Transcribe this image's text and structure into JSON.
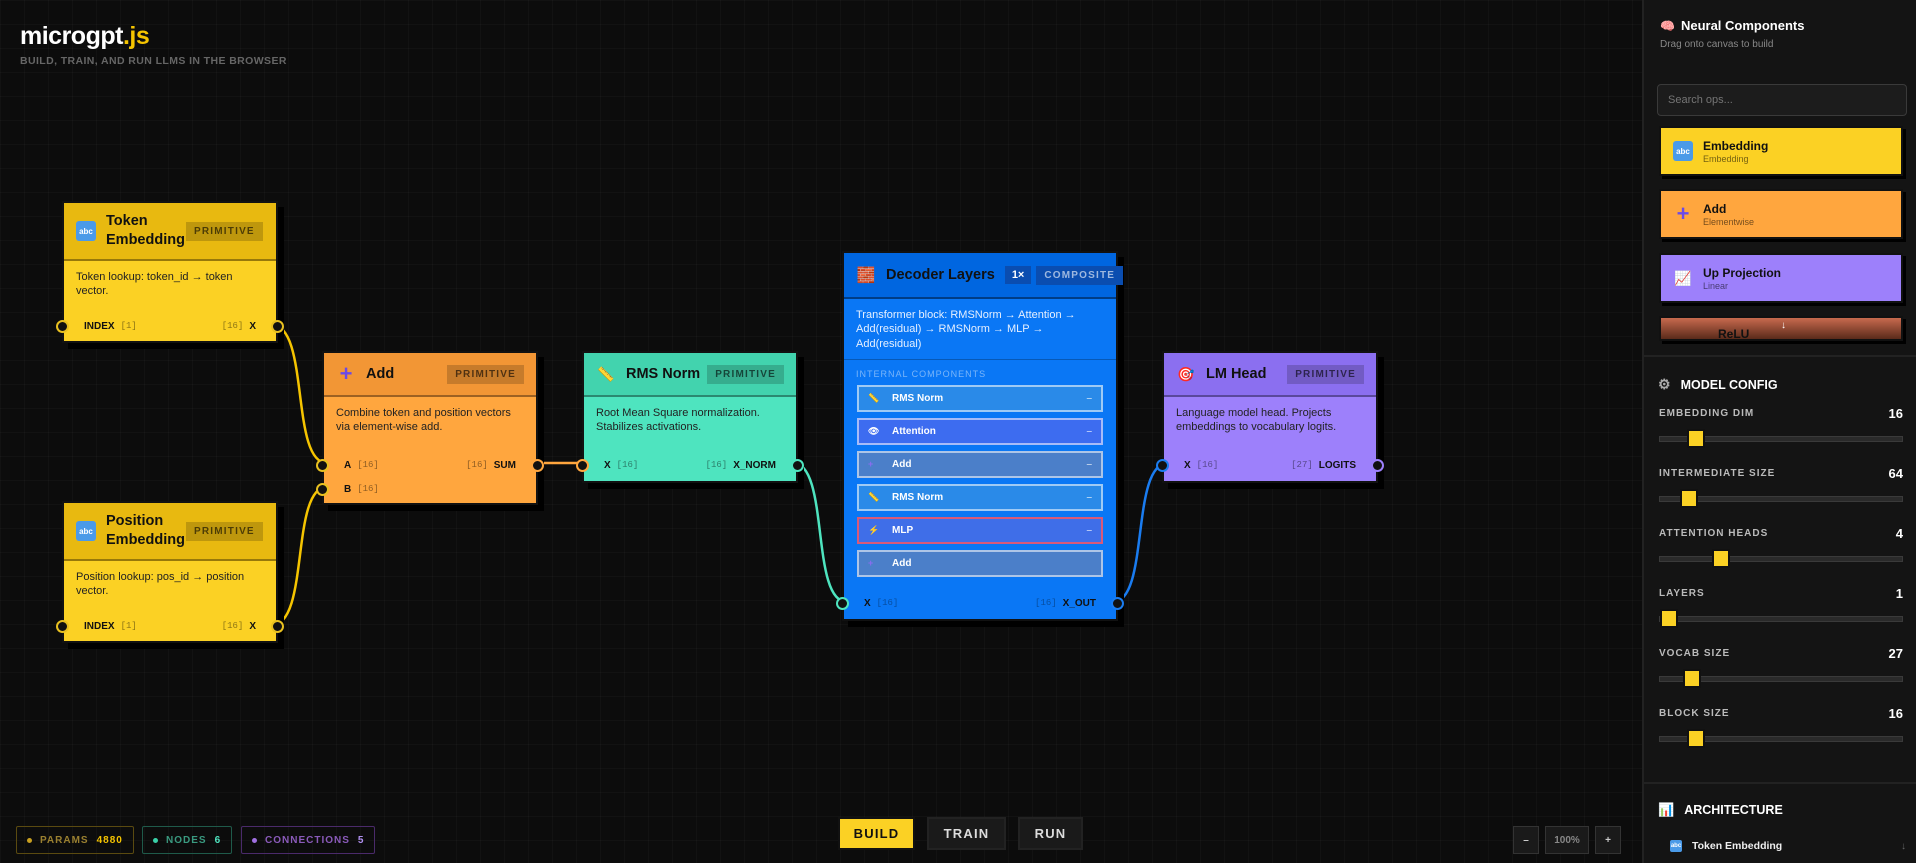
{
  "brand": {
    "title": "microgpt",
    "title_ext": ".js",
    "subtitle": "BUILD, TRAIN, AND RUN LLMS IN THE BROWSER"
  },
  "nodes": {
    "token_embedding": {
      "title": "Token Embedding",
      "badge": "PRIMITIVE",
      "desc": "Token lookup: token_id → token vector.",
      "in_label": "INDEX",
      "in_shape": "[1]",
      "out_shape": "[16]",
      "out_label": "X",
      "icon": "abc-icon"
    },
    "position_embedding": {
      "title": "Position Embedding",
      "badge": "PRIMITIVE",
      "desc": "Position lookup: pos_id → position vector.",
      "in_label": "INDEX",
      "in_shape": "[1]",
      "out_shape": "[16]",
      "out_label": "X",
      "icon": "abc-icon"
    },
    "add": {
      "title": "Add",
      "badge": "PRIMITIVE",
      "desc": "Combine token and position vectors via element-wise add.",
      "in_a": "A",
      "in_a_shape": "[16]",
      "in_b": "B",
      "in_b_shape": "[16]",
      "out_shape": "[16]",
      "out_label": "SUM",
      "icon": "plus-icon"
    },
    "rms_norm": {
      "title": "RMS Norm",
      "badge": "PRIMITIVE",
      "desc": "Root Mean Square normalization. Stabilizes activations.",
      "in_label": "X",
      "in_shape": "[16]",
      "out_shape": "[16]",
      "out_label": "X_NORM",
      "icon": "ruler-icon"
    },
    "decoder": {
      "title": "Decoder Layers",
      "repeat": "1×",
      "badge": "COMPOSITE",
      "desc": "Transformer block: RMSNorm → Attention → Add(residual) → RMSNorm → MLP → Add(residual)",
      "internal_heading": "INTERNAL COMPONENTS",
      "components": [
        {
          "name": "RMS Norm",
          "mark": "–",
          "icon": "ruler-icon"
        },
        {
          "name": "Attention",
          "mark": "–",
          "icon": "eye-icon"
        },
        {
          "name": "Add",
          "mark": "–",
          "icon": "plus-icon"
        },
        {
          "name": "RMS Norm",
          "mark": "–",
          "icon": "ruler-icon"
        },
        {
          "name": "MLP",
          "mark": "–",
          "icon": "bolt-icon"
        },
        {
          "name": "Add",
          "mark": "",
          "icon": "plus-icon"
        }
      ],
      "in_label": "X",
      "in_shape": "[16]",
      "out_shape": "[16]",
      "out_label": "X_OUT",
      "icon": "brick-icon"
    },
    "lm_head": {
      "title": "LM Head",
      "badge": "PRIMITIVE",
      "desc": "Language model head. Projects embeddings to vocabulary logits.",
      "in_label": "X",
      "in_shape": "[16]",
      "out_shape": "[27]",
      "out_label": "LOGITS",
      "icon": "target-icon"
    }
  },
  "sidebar": {
    "title": "Neural Components",
    "subtitle": "Drag onto canvas to build",
    "search_placeholder": "Search ops...",
    "palette": [
      {
        "name": "Embedding",
        "desc": "Embedding",
        "icon": "abc-icon",
        "color": "#fbd124"
      },
      {
        "name": "Add",
        "desc": "Elementwise",
        "icon": "plus-icon",
        "color": "#ffa63e"
      },
      {
        "name": "Up Projection",
        "desc": "Linear",
        "icon": "chart-icon",
        "color": "#9d80fb"
      },
      {
        "name": "ReLU",
        "desc": "",
        "icon": "",
        "color": "#c86a4e"
      }
    ],
    "model_config_title": "MODEL CONFIG",
    "config": [
      {
        "label": "EMBEDDING DIM",
        "value": "16",
        "level": 0.12
      },
      {
        "label": "INTERMEDIATE SIZE",
        "value": "64",
        "level": 0.09
      },
      {
        "label": "ATTENTION HEADS",
        "value": "4",
        "level": 0.23
      },
      {
        "label": "LAYERS",
        "value": "1",
        "level": 0.0
      },
      {
        "label": "VOCAB SIZE",
        "value": "27",
        "level": 0.1
      },
      {
        "label": "BLOCK SIZE",
        "value": "16",
        "level": 0.12
      }
    ],
    "architecture_title": "ARCHITECTURE",
    "architecture_items": [
      {
        "name": "Token Embedding",
        "mark": "↓"
      }
    ]
  },
  "status": {
    "params_label": "PARAMS",
    "params_value": "4880",
    "nodes_label": "NODES",
    "nodes_value": "6",
    "connections_label": "CONNECTIONS",
    "connections_value": "5"
  },
  "modes": {
    "build": "BUILD",
    "train": "TRAIN",
    "run": "RUN",
    "active": "BUILD"
  },
  "zoom": {
    "minus": "–",
    "value": "100%",
    "plus": "+"
  },
  "colors": {
    "yellow": "#fbd124",
    "orange": "#ffa63e",
    "teal": "#4ee4bf",
    "blue": "#0a77f5",
    "purple": "#9d80fb"
  }
}
